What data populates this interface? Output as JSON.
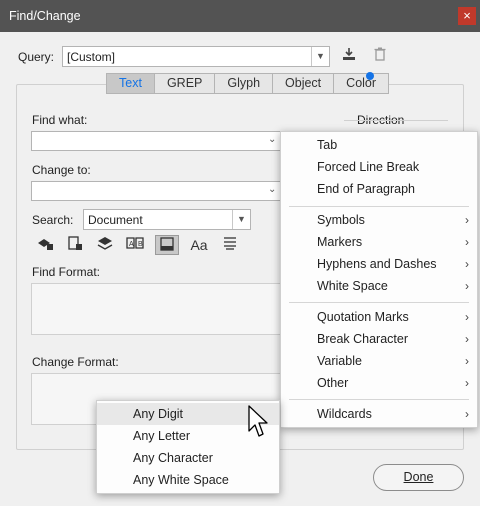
{
  "window": {
    "title": "Find/Change",
    "close_glyph": "×"
  },
  "query": {
    "label": "Query:",
    "value": "[Custom]"
  },
  "tabs": [
    {
      "label": "Text",
      "active": true
    },
    {
      "label": "GREP"
    },
    {
      "label": "Glyph"
    },
    {
      "label": "Object"
    },
    {
      "label": "Color"
    }
  ],
  "find": {
    "label": "Find what:",
    "value": ""
  },
  "change": {
    "label": "Change to:",
    "value": ""
  },
  "direction": {
    "label": "Direction"
  },
  "search": {
    "label": "Search:",
    "value": "Document"
  },
  "find_format": {
    "label": "Find Format:"
  },
  "change_format": {
    "label": "Change Format:"
  },
  "done": {
    "label": "Done"
  },
  "menu": {
    "items": [
      {
        "label": "Tab"
      },
      {
        "label": "Forced Line Break"
      },
      {
        "label": "End of Paragraph"
      },
      {
        "label": "Symbols",
        "sub": "›"
      },
      {
        "label": "Markers",
        "sub": "›"
      },
      {
        "label": "Hyphens and Dashes",
        "sub": "›"
      },
      {
        "label": "White Space",
        "sub": "›"
      },
      {
        "label": "Quotation Marks",
        "sub": "›"
      },
      {
        "label": "Break Character",
        "sub": "›"
      },
      {
        "label": "Variable",
        "sub": "›"
      },
      {
        "label": "Other",
        "sub": "›"
      },
      {
        "label": "Wildcards",
        "sub": "›"
      }
    ]
  },
  "submenu": {
    "items": [
      {
        "label": "Any Digit"
      },
      {
        "label": "Any Letter"
      },
      {
        "label": "Any Character"
      },
      {
        "label": "Any White Space"
      }
    ]
  },
  "colors": {
    "titlebar": "#535353",
    "close": "#c0392b",
    "accent": "#1473e6"
  }
}
